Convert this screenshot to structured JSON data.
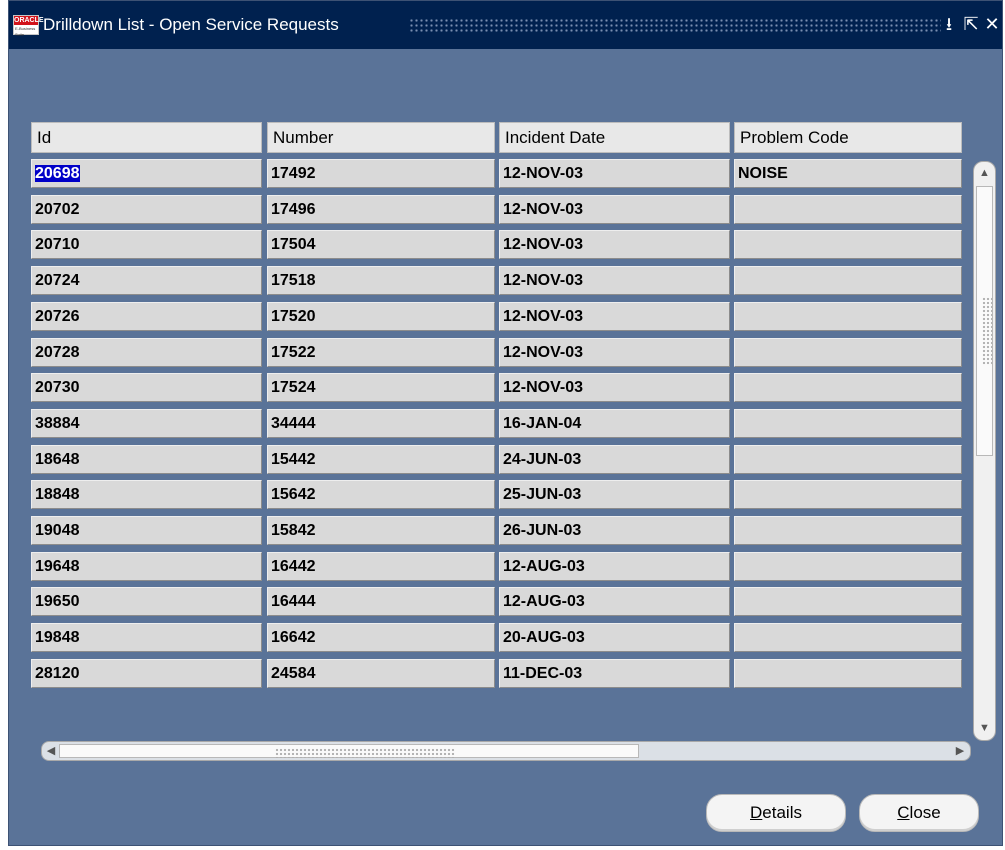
{
  "window": {
    "title": "Drilldown List - Open Service Requests",
    "logo_text": "ORACLE",
    "logo_subtext": "E-Business Suite",
    "controls": {
      "minimize": "⭳",
      "maximize": "⇱",
      "close": "✕"
    }
  },
  "table": {
    "columns": [
      "Id",
      "Number",
      "Incident Date",
      "Problem Code"
    ],
    "rows": [
      [
        "20698",
        "17492",
        "12-NOV-03",
        "NOISE"
      ],
      [
        "20702",
        "17496",
        "12-NOV-03",
        ""
      ],
      [
        "20710",
        "17504",
        "12-NOV-03",
        ""
      ],
      [
        "20724",
        "17518",
        "12-NOV-03",
        ""
      ],
      [
        "20726",
        "17520",
        "12-NOV-03",
        ""
      ],
      [
        "20728",
        "17522",
        "12-NOV-03",
        ""
      ],
      [
        "20730",
        "17524",
        "12-NOV-03",
        ""
      ],
      [
        "38884",
        "34444",
        "16-JAN-04",
        ""
      ],
      [
        "18648",
        "15442",
        "24-JUN-03",
        ""
      ],
      [
        "18848",
        "15642",
        "25-JUN-03",
        ""
      ],
      [
        "19048",
        "15842",
        "26-JUN-03",
        ""
      ],
      [
        "19648",
        "16442",
        "12-AUG-03",
        ""
      ],
      [
        "19650",
        "16444",
        "12-AUG-03",
        ""
      ],
      [
        "19848",
        "16642",
        "20-AUG-03",
        ""
      ],
      [
        "28120",
        "24584",
        "11-DEC-03",
        ""
      ]
    ],
    "selected_row": 0,
    "selected_col": 0
  },
  "scroll": {
    "up": "▲",
    "down": "▼",
    "left": "◀",
    "right": "▶"
  },
  "buttons": {
    "details_mnemonic": "D",
    "details_rest": "etails",
    "close_mnemonic": "C",
    "close_rest": "lose"
  },
  "colors": {
    "window_bg": "#5a7398",
    "titlebar_bg": "#00214f",
    "selection": "#0000c8"
  }
}
